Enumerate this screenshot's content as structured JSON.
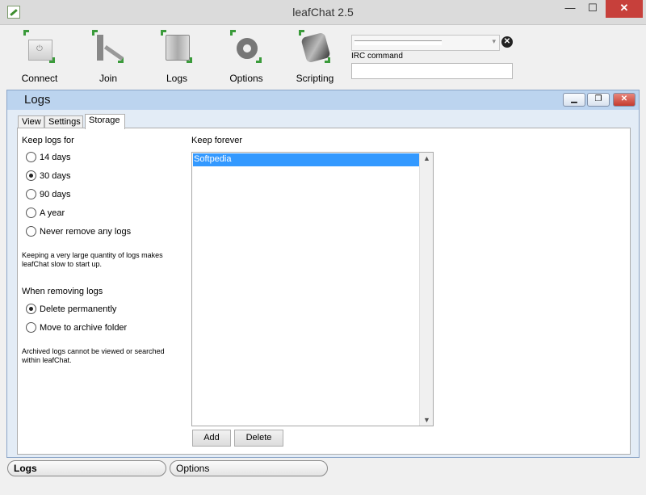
{
  "window": {
    "title": "leafChat 2.5",
    "close_glyph": "✕",
    "minimize_glyph": "—",
    "maximize_glyph": "☐"
  },
  "toolbar": {
    "items": [
      {
        "label": "Connect",
        "icon": "power-icon"
      },
      {
        "label": "Join",
        "icon": "join-icon"
      },
      {
        "label": "Logs",
        "icon": "book-icon"
      },
      {
        "label": "Options",
        "icon": "options-icon"
      },
      {
        "label": "Scripting",
        "icon": "scripting-icon"
      }
    ],
    "irc_label": "IRC command",
    "irc_input_value": "",
    "clear_glyph": "✕",
    "accent_color": "#3b9b3b"
  },
  "inner": {
    "title": "Logs",
    "tabs": [
      "View",
      "Settings",
      "Storage"
    ],
    "active_tab": "Storage"
  },
  "storage": {
    "keep_heading": "Keep logs for",
    "keep_options": [
      "14 days",
      "30 days",
      "90 days",
      "A year",
      "Never remove any logs"
    ],
    "keep_selected": "30 days",
    "keep_note": "Keeping a very large quantity of logs makes leafChat slow to start up.",
    "remove_heading": "When removing logs",
    "remove_options": [
      "Delete permanently",
      "Move to archive folder"
    ],
    "remove_selected": "Delete permanently",
    "remove_note": "Archived logs cannot be viewed or searched within leafChat.",
    "forever_heading": "Keep forever",
    "forever_items": [
      "Softpedia"
    ],
    "add_label": "Add",
    "delete_label": "Delete"
  },
  "bottom_tabs": [
    "Logs",
    "Options"
  ],
  "colors": {
    "selection": "#3399ff",
    "close_red": "#c7403b",
    "inner_titlebar": "#bcd4ef"
  }
}
